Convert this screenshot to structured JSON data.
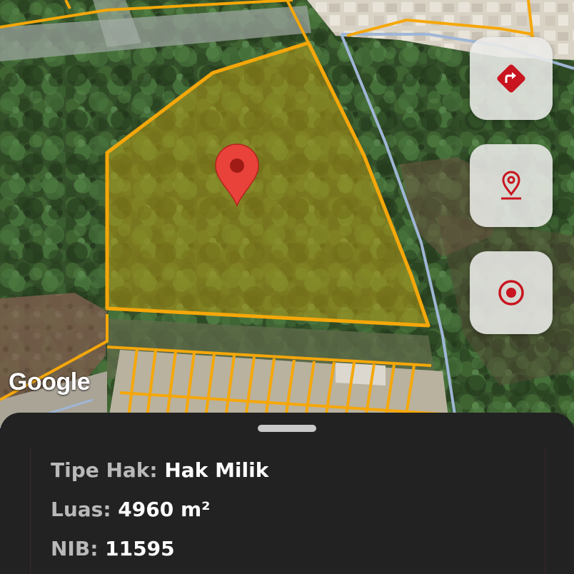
{
  "map": {
    "provider_watermark": "Google",
    "parcel_fill_color": "#b59a17",
    "parcel_border_color": "#f5a70a",
    "road_color": "#9fb6d6",
    "marker_color": "#e8423b",
    "marker_icon": "map-marker-icon"
  },
  "actions": {
    "directions": {
      "icon": "directions-icon",
      "color": "#c8151f"
    },
    "place_pin": {
      "icon": "place-pin-icon",
      "color": "#c8151f"
    },
    "my_location": {
      "icon": "my-location-icon",
      "color": "#c8151f"
    }
  },
  "parcel_info": {
    "rights_type": {
      "label": "Tipe Hak:",
      "value": "Hak Milik"
    },
    "area": {
      "label": "Luas:",
      "value": "4960 m²"
    },
    "nib": {
      "label": "NIB:",
      "value": "11595"
    }
  }
}
